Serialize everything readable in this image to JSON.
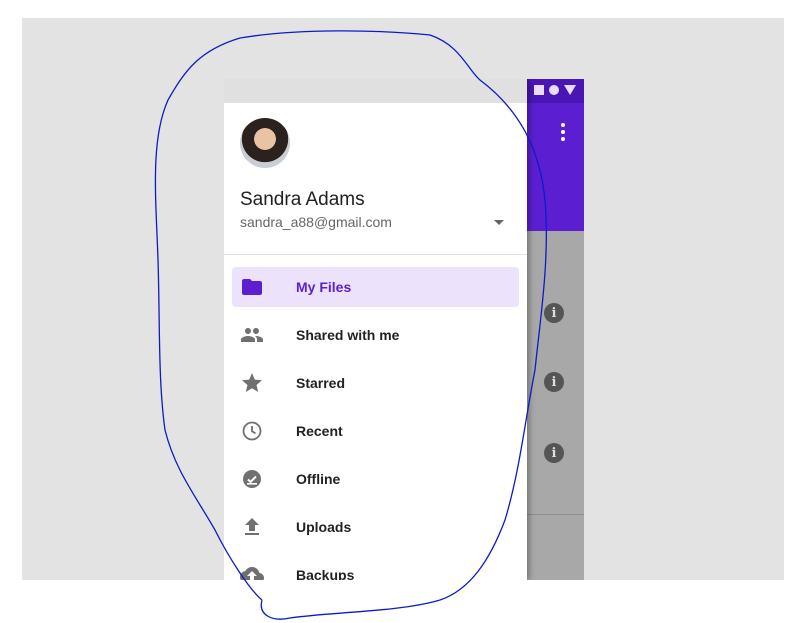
{
  "colors": {
    "accent": "#5b1fd1",
    "active_bg": "#ede2fc",
    "annotation": "#0a1cc9"
  },
  "status_icons": [
    "square-icon",
    "circle-icon",
    "triangle-icon"
  ],
  "account": {
    "name": "Sandra Adams",
    "email": "sandra_a88@gmail.com"
  },
  "nav": {
    "items": [
      {
        "label": "My Files",
        "icon": "folder-icon",
        "active": true
      },
      {
        "label": "Shared with me",
        "icon": "people-icon",
        "active": false
      },
      {
        "label": "Starred",
        "icon": "star-icon",
        "active": false
      },
      {
        "label": "Recent",
        "icon": "clock-icon",
        "active": false
      },
      {
        "label": "Offline",
        "icon": "offline-icon",
        "active": false
      },
      {
        "label": "Uploads",
        "icon": "upload-icon",
        "active": false
      },
      {
        "label": "Backups",
        "icon": "backup-icon",
        "active": false
      }
    ]
  },
  "content": {
    "info_icon_glyph": "i"
  }
}
